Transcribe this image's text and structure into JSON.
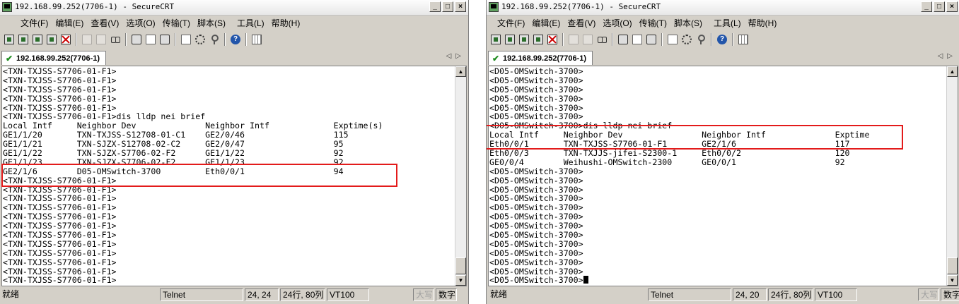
{
  "windows": [
    {
      "title": "192.168.99.252(7706-1) - SecureCRT",
      "menu": [
        "文件(F)",
        "编辑(E)",
        "查看(V)",
        "选项(O)",
        "传输(T)",
        "脚本(S)",
        "工具(L)",
        "帮助(H)"
      ],
      "tab_label": "192.168.99.252(7706-1)",
      "terminal_lines": [
        "<TXN-TXJSS-S7706-01-F1>",
        "<TXN-TXJSS-S7706-01-F1>",
        "<TXN-TXJSS-S7706-01-F1>",
        "<TXN-TXJSS-S7706-01-F1>",
        "<TXN-TXJSS-S7706-01-F1>",
        "<TXN-TXJSS-S7706-01-F1>dis lldp nei brief",
        "Local Intf     Neighbor Dev              Neighbor Intf             Exptime(s)",
        "GE1/1/20       TXN-TXJSS-S12708-01-C1    GE2/0/46                  115",
        "GE1/1/21       TXN-SJZX-S12708-02-C2     GE2/0/47                  95",
        "GE1/1/22       TXN-SJZX-S7706-02-F2      GE1/1/22                  92",
        "GE1/1/23       TXN-SJZX-S7706-02-F2      GE1/1/23                  92",
        "GE2/1/6        D05-OMSwitch-3700         Eth0/0/1                  94",
        "<TXN-TXJSS-S7706-01-F1>",
        "<TXN-TXJSS-S7706-01-F1>",
        "<TXN-TXJSS-S7706-01-F1>",
        "<TXN-TXJSS-S7706-01-F1>",
        "<TXN-TXJSS-S7706-01-F1>",
        "<TXN-TXJSS-S7706-01-F1>",
        "<TXN-TXJSS-S7706-01-F1>",
        "<TXN-TXJSS-S7706-01-F1>",
        "<TXN-TXJSS-S7706-01-F1>",
        "<TXN-TXJSS-S7706-01-F1>",
        "<TXN-TXJSS-S7706-01-F1>",
        "<TXN-TXJSS-S7706-01-F1>"
      ],
      "status": {
        "ready": "就绪",
        "protocol": "Telnet",
        "cursor_pos": "24,  24",
        "size": "24行, 80列",
        "emulation": "VT100",
        "caps": "大写",
        "num": "数字"
      }
    },
    {
      "title": "192.168.99.252(7706-1) - SecureCRT",
      "menu": [
        "文件(F)",
        "编辑(E)",
        "查看(V)",
        "选项(O)",
        "传输(T)",
        "脚本(S)",
        "工具(L)",
        "帮助(H)"
      ],
      "tab_label": "192.168.99.252(7706-1)",
      "terminal_lines": [
        "<D05-OMSwitch-3700>",
        "<D05-OMSwitch-3700>",
        "<D05-OMSwitch-3700>",
        "<D05-OMSwitch-3700>",
        "<D05-OMSwitch-3700>",
        "<D05-OMSwitch-3700>",
        "<D05-OMSwitch-3700>dis lldp nei brief",
        "Local Intf     Neighbor Dev                Neighbor Intf              Exptime",
        "Eth0/0/1       TXN-TXJSS-S7706-01-F1       GE2/1/6                    117",
        "Eth0/0/3       TXN-TXJJS-jifei-S2300-1     Eth0/0/2                   120",
        "GE0/0/4        Weihushi-OMSwitch-2300      GE0/0/1                    92",
        "<D05-OMSwitch-3700>",
        "<D05-OMSwitch-3700>",
        "<D05-OMSwitch-3700>",
        "<D05-OMSwitch-3700>",
        "<D05-OMSwitch-3700>",
        "<D05-OMSwitch-3700>",
        "<D05-OMSwitch-3700>",
        "<D05-OMSwitch-3700>",
        "<D05-OMSwitch-3700>",
        "<D05-OMSwitch-3700>",
        "<D05-OMSwitch-3700>",
        "<D05-OMSwitch-3700>",
        "<D05-OMSwitch-3700>"
      ],
      "status": {
        "ready": "就绪",
        "protocol": "Telnet",
        "cursor_pos": "24,  20",
        "size": "24行, 80列",
        "emulation": "VT100",
        "caps": "大写",
        "num": "数字"
      }
    }
  ],
  "colors": {
    "highlight_box": "#e31b1b",
    "window_chrome": "#d4d0c8",
    "terminal_bg": "#ffffff"
  },
  "icons": {
    "window_buttons": [
      "minimize-icon",
      "maximize-icon",
      "close-icon"
    ],
    "toolbar": [
      "connect-icon",
      "quick-connect-icon",
      "connect-tab-icon",
      "reconnect-icon",
      "disconnect-icon",
      "copy-icon",
      "paste-icon",
      "find-icon",
      "print-setup-icon",
      "log-icon",
      "print-icon",
      "session-options-icon",
      "global-options-icon",
      "key-icon",
      "help-icon",
      "keymap-icon"
    ]
  }
}
